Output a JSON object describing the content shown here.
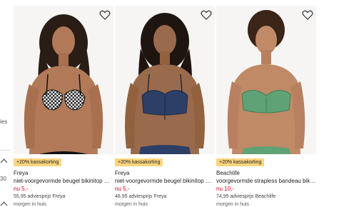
{
  "sidebar": {
    "partial_text": "ies",
    "partial_number": "30"
  },
  "products": [
    {
      "badge": "+20% kassakorting",
      "brand": "Freya",
      "title": "niet-voorgevormde beugel bikinitop Ch...",
      "price": "nu 5,-",
      "advice": "55,95 adviesprijs Freya",
      "delivery": "morgen in huis",
      "colors": {
        "top": "#2a2a2a",
        "pattern": "gingham"
      }
    },
    {
      "badge": "+20% kassakorting",
      "brand": "Freya",
      "title": "niet-voorgevormde beugel bikinitop Sun...",
      "price": "nu 5,-",
      "advice": "48,95 adviesprijs Freya",
      "delivery": "morgen in huis",
      "colors": {
        "top": "#2c3f66",
        "pattern": "solid"
      }
    },
    {
      "badge": "+20% kassakorting",
      "brand": "Beachlife",
      "title": "voorgevormde strapless bandeau bikinit...",
      "price": "nu 10,-",
      "advice": "74,95 adviesprijs Beachlife",
      "delivery": "morgen in huis",
      "colors": {
        "top": "#5fa275",
        "pattern": "solid"
      }
    }
  ],
  "icons": {
    "favorite": "heart-outline-icon",
    "collapse": "chevron-up-icon"
  },
  "theme": {
    "price_color": "#e2001a",
    "badge_color": "#fcd57e"
  }
}
